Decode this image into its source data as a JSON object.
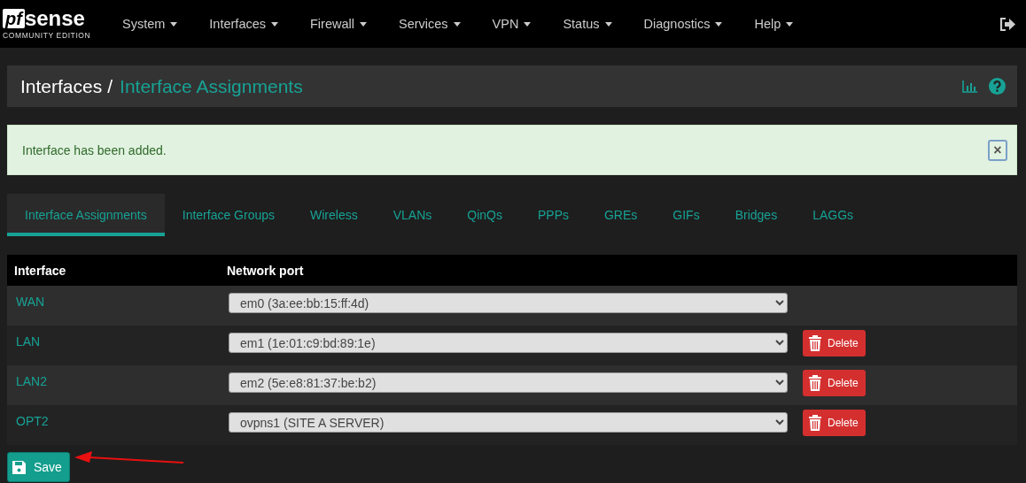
{
  "logo": {
    "mark": "pf",
    "name": "sense",
    "edition": "COMMUNITY EDITION"
  },
  "nav": {
    "items": [
      "System",
      "Interfaces",
      "Firewall",
      "Services",
      "VPN",
      "Status",
      "Diagnostics",
      "Help"
    ]
  },
  "breadcrumb": {
    "parent": "Interfaces",
    "separator": "/",
    "current": "Interface Assignments"
  },
  "alert": {
    "message": "Interface has been added.",
    "close": "×"
  },
  "tabs": [
    {
      "label": "Interface Assignments",
      "selected": true
    },
    {
      "label": "Interface Groups",
      "selected": false
    },
    {
      "label": "Wireless",
      "selected": false
    },
    {
      "label": "VLANs",
      "selected": false
    },
    {
      "label": "QinQs",
      "selected": false
    },
    {
      "label": "PPPs",
      "selected": false
    },
    {
      "label": "GREs",
      "selected": false
    },
    {
      "label": "GIFs",
      "selected": false
    },
    {
      "label": "Bridges",
      "selected": false
    },
    {
      "label": "LAGGs",
      "selected": false
    }
  ],
  "table": {
    "columns": [
      "Interface",
      "Network port"
    ],
    "rows": [
      {
        "interface": "WAN",
        "port": "em0 (3a:ee:bb:15:ff:4d)",
        "delete": null
      },
      {
        "interface": "LAN",
        "port": "em1 (1e:01:c9:bd:89:1e)",
        "delete": "Delete"
      },
      {
        "interface": "LAN2",
        "port": "em2 (5e:e8:81:37:be:b2)",
        "delete": "Delete"
      },
      {
        "interface": "OPT2",
        "port": "ovpns1 (SITE A SERVER)",
        "delete": "Delete"
      }
    ]
  },
  "save_button": {
    "label": "Save"
  },
  "annotation": {
    "kind": "arrow",
    "color": "#e81010"
  }
}
